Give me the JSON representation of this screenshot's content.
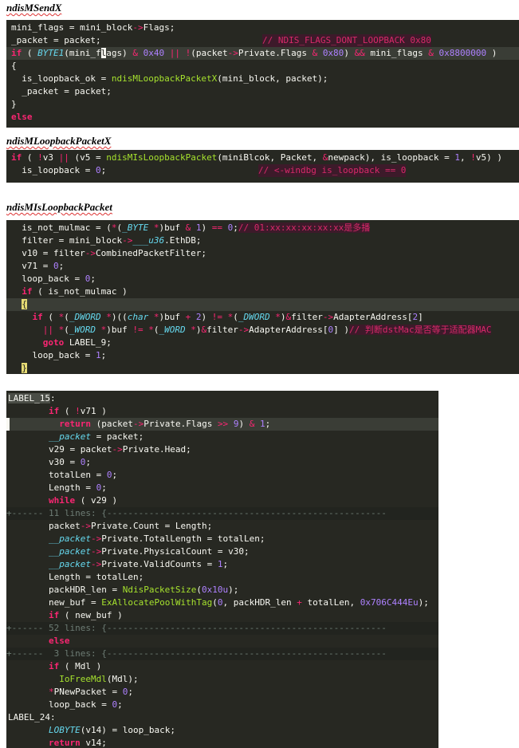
{
  "headings": {
    "send": "ndisMSendX",
    "loopback": "ndisMLoopbackPacketX",
    "isloop": "ndisMIsLoopbackPacket"
  },
  "block1": [
    "mini_flags = mini_block->Flags;",
    "_packet = packet;",
    "// NDIS_FLAGS_DONT_LOOPBACK 0x80",
    "if ( BYTE1(mini_flags) & 0x40 || !(packet->Private.Flags & 0x80) && mini_flags & 0x8800000 )",
    "{",
    "  is_loopback_ok = ndisMLoopbackPacketX(mini_block, packet);",
    "  _packet = packet;",
    "}",
    "else"
  ],
  "block2": [
    "if ( !v3 || (v5 = ndisMIsLoopbackPacket(miniBlcok, Packet, &newpack), is_loopback = 1, !v5) )",
    "  is_loopback = 0;",
    "// <-windbg is_loopback == 0"
  ],
  "block3": [
    "  is_not_mulmac = (*(_BYTE *)buf & 1) == 0;",
    "// 01:xx:xx:xx:xx:xx是多播",
    "  filter = mini_block->___u36.EthDB;",
    "  v10 = filter->CombinedPacketFilter;",
    "  v71 = 0;",
    "  loop_back = 0;",
    "  if ( is_not_mulmac )",
    "  {",
    "    if ( *(_DWORD *)((char *)buf + 2) != *(_DWORD *)&filter->AdapterAddress[2]",
    "      || *(_WORD *)buf != *(_WORD *)&filter->AdapterAddress[0] )",
    "// 判断dstMac是否等于适配器MAC",
    "      goto LABEL_9;",
    "    loop_back = 1;",
    "  }"
  ],
  "block4": [
    "LABEL_15:",
    "        if ( !v71 )",
    "          return (packet->Private.Flags >> 9) & 1;",
    "        __packet = packet;",
    "        v29 = packet->Private.Head;",
    "        v30 = 0;",
    "        totalLen = 0;",
    "        Length = 0;",
    "        while ( v29 )",
    "+------ 11 lines: {-----------------------------------------------------",
    "        packet->Private.Count = Length;",
    "        __packet->Private.TotalLength = totalLen;",
    "        __packet->Private.PhysicalCount = v30;",
    "        __packet->Private.ValidCounts = 1;",
    "        Length = totalLen;",
    "        packHDR_len = NdisPacketSize(0x10u);",
    "        new_buf = ExAllocatePoolWithTag(0, packHDR_len + totalLen, 0x706C444Eu);",
    "        if ( new_buf )",
    "+------ 52 lines: {-----------------------------------------------------",
    "        else",
    "+------  3 lines: {-----------------------------------------------------",
    "        if ( Mdl )",
    "          IoFreeMdl(Mdl);",
    "        *PNewPacket = 0;",
    "        loop_back = 0;",
    "LABEL_24:",
    "        LOBYTE(v14) = loop_back;",
    "        return v14;"
  ],
  "colors": {
    "editor_bg": "#272822",
    "keyword": "#f92672",
    "function": "#a6e22e",
    "number": "#ae81ff",
    "type": "#66d9ef",
    "text": "#f8f8f2"
  }
}
